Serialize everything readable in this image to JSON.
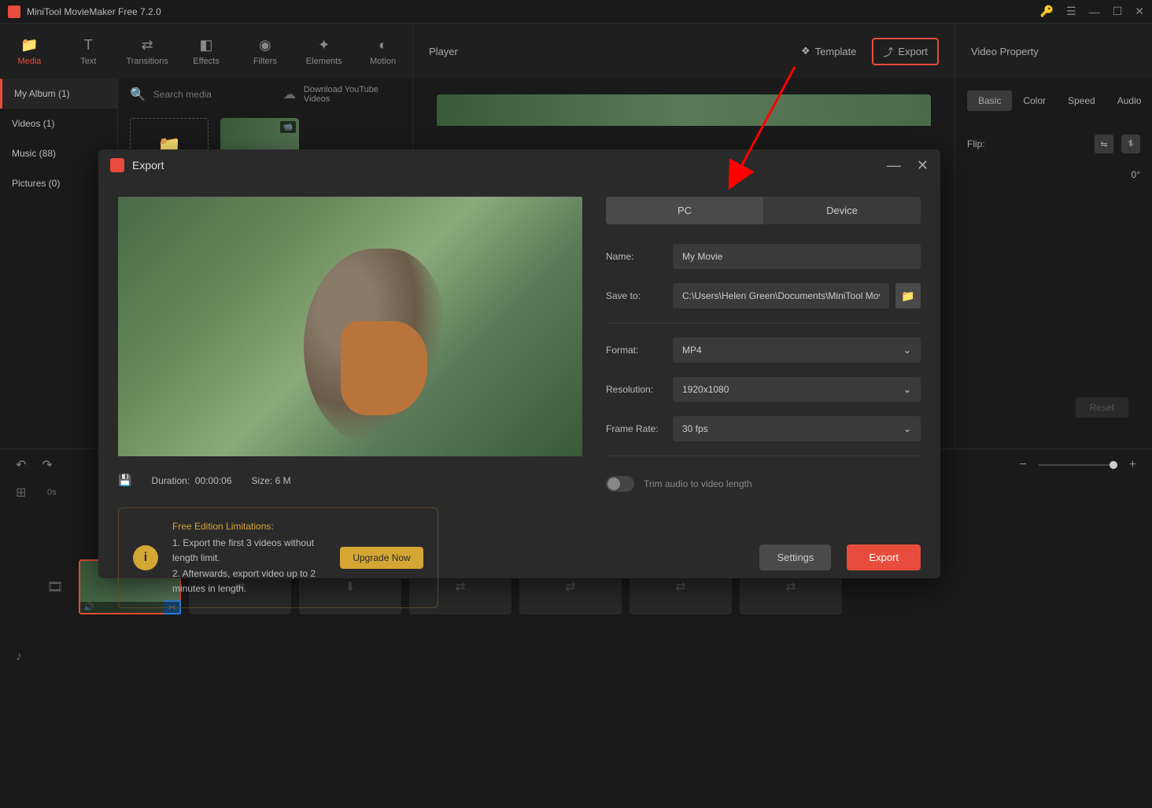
{
  "titlebar": {
    "title": "MiniTool MovieMaker Free 7.2.0"
  },
  "toolbar": {
    "tabs": [
      {
        "label": "Media"
      },
      {
        "label": "Text"
      },
      {
        "label": "Transitions"
      },
      {
        "label": "Effects"
      },
      {
        "label": "Filters"
      },
      {
        "label": "Elements"
      },
      {
        "label": "Motion"
      }
    ],
    "player_label": "Player",
    "template_label": "Template",
    "export_label": "Export",
    "prop_label": "Video Property"
  },
  "sidebar": {
    "items": [
      {
        "label": "My Album (1)"
      },
      {
        "label": "Videos (1)"
      },
      {
        "label": "Music (88)"
      },
      {
        "label": "Pictures (0)"
      }
    ]
  },
  "media": {
    "search_placeholder": "Search media",
    "download_label": "Download YouTube Videos"
  },
  "props": {
    "tabs": [
      "Basic",
      "Color",
      "Speed",
      "Audio"
    ],
    "flip_label": "Flip:",
    "rotate_value": "0°",
    "reset_label": "Reset"
  },
  "timeline": {
    "time": "0s"
  },
  "export": {
    "title": "Export",
    "tabs": {
      "pc": "PC",
      "device": "Device"
    },
    "name_label": "Name:",
    "name_value": "My Movie",
    "saveto_label": "Save to:",
    "saveto_value": "C:\\Users\\Helen Green\\Documents\\MiniTool MovieM",
    "format_label": "Format:",
    "format_value": "MP4",
    "resolution_label": "Resolution:",
    "resolution_value": "1920x1080",
    "framerate_label": "Frame Rate:",
    "framerate_value": "30 fps",
    "trim_label": "Trim audio to video length",
    "duration_label": "Duration:",
    "duration_value": "00:00:06",
    "size_label": "Size:",
    "size_value": "6 M",
    "limit_title": "Free Edition Limitations:",
    "limit_line1": "1. Export the first 3 videos without length limit.",
    "limit_line2": "2. Afterwards, export video up to 2 minutes in length.",
    "upgrade_label": "Upgrade Now",
    "settings_label": "Settings",
    "export_label": "Export"
  }
}
